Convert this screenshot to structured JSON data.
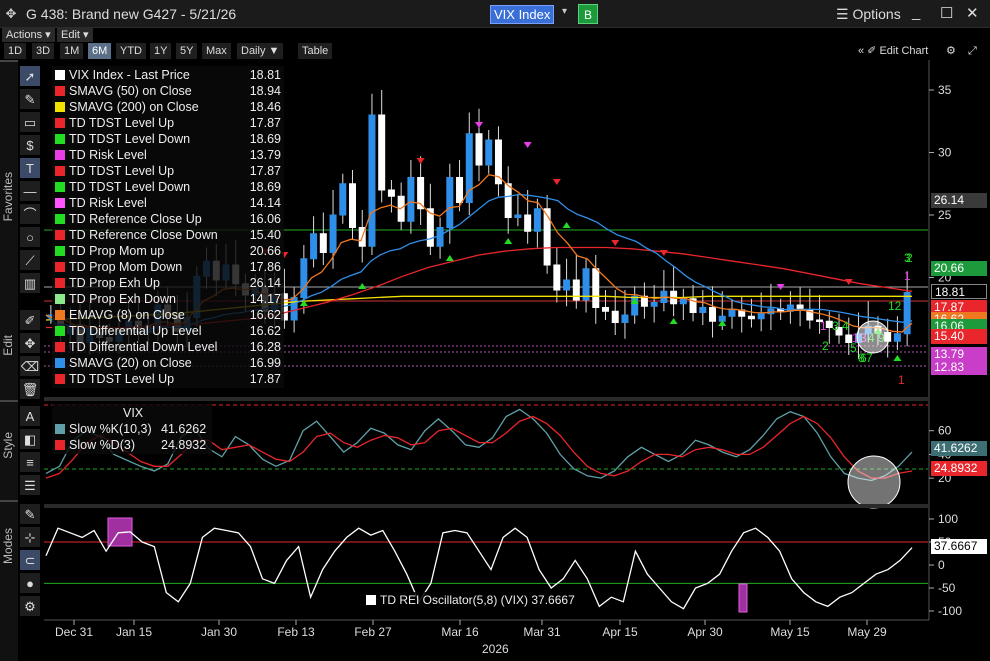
{
  "window": {
    "title": "G 438: Brand new G427 - 5/21/26",
    "ticker": "VIX Index",
    "badge": "B",
    "options_label": "Options",
    "move_icon": "✥",
    "min_icon": "_",
    "max_icon": "☐",
    "close_icon": "✕",
    "dropdown_icon": "▾"
  },
  "menu": {
    "actions": "Actions ▾",
    "edit": "Edit ▾"
  },
  "toolbar": {
    "timeframes": [
      "1D",
      "3D",
      "1M",
      "6M",
      "YTD",
      "1Y",
      "5Y",
      "Max"
    ],
    "active_timeframe": "6M",
    "interval": "Daily ▼",
    "table": "Table",
    "edit_chart": "« ✐ Edit Chart",
    "gear": "⚙",
    "expand": "⤢"
  },
  "sidebar": {
    "favorites": "Favorites",
    "edit": "Edit",
    "style": "Style",
    "modes": "Modes"
  },
  "legend_main": [
    {
      "name": "VIX Index - Last Price",
      "value": "18.81",
      "color": "#ffffff"
    },
    {
      "name": "SMAVG (50)  on Close",
      "value": "18.94",
      "color": "#e8262b"
    },
    {
      "name": "SMAVG (200)  on Close",
      "value": "18.46",
      "color": "#f2e200"
    },
    {
      "name": "TD TDST Level Up",
      "value": "17.87",
      "color": "#e8262b"
    },
    {
      "name": "TD TDST Level Down",
      "value": "18.69",
      "color": "#22dd22"
    },
    {
      "name": "TD Risk Level",
      "value": "13.79",
      "color": "#e83ee8"
    },
    {
      "name": "TD TDST Level Up",
      "value": "17.87",
      "color": "#e8262b"
    },
    {
      "name": "TD TDST Level Down",
      "value": "18.69",
      "color": "#22dd22"
    },
    {
      "name": "TD Risk Level",
      "value": "14.14",
      "color": "#ff55ff"
    },
    {
      "name": "TD Reference Close Up",
      "value": "16.06",
      "color": "#22dd22"
    },
    {
      "name": "TD Reference Close Down",
      "value": "15.40",
      "color": "#e8262b"
    },
    {
      "name": "TD Prop Mom up",
      "value": "20.66",
      "color": "#22dd22"
    },
    {
      "name": "TD Prop Mom Down",
      "value": "17.86",
      "color": "#e8262b"
    },
    {
      "name": "TD Prop Exh Up",
      "value": "26.14",
      "color": "#e8262b"
    },
    {
      "name": "TD Prop Exh Down",
      "value": "14.17",
      "color": "#8ee88e"
    },
    {
      "name": "EMAVG (8)  on Close",
      "value": "16.62",
      "color": "#f07820"
    },
    {
      "name": "TD Differential Up Level",
      "value": "16.62",
      "color": "#22dd22"
    },
    {
      "name": "TD Differential Down Level",
      "value": "16.28",
      "color": "#e8262b"
    },
    {
      "name": "SMAVG (20)  on Close",
      "value": "16.99",
      "color": "#2f8fe8"
    },
    {
      "name": "TD TDST Level Up",
      "value": "17.87",
      "color": "#e8262b"
    }
  ],
  "legend_stoch": {
    "title": "VIX",
    "rows": [
      {
        "name": "Slow %K(10,3)",
        "value": "41.6262",
        "color": "#5fa0a8"
      },
      {
        "name": "Slow %D(3)",
        "value": "24.8932",
        "color": "#e8262b"
      }
    ]
  },
  "legend_rei": {
    "name": "TD REI Oscillator(5,8) (VIX)",
    "value": "37.6667",
    "color": "#ffffff"
  },
  "axes": {
    "main_ticks": [
      "35",
      "30",
      "25",
      "20"
    ],
    "stoch_ticks": [
      "60",
      "40",
      "20"
    ],
    "rei_ticks": [
      "100",
      "50",
      "0",
      "-50",
      "-100"
    ],
    "x_labels": [
      "Dec 31",
      "Jan 15",
      "Jan 30",
      "Feb 13",
      "Feb 27",
      "Mar 16",
      "Mar 31",
      "Apr 15",
      "Apr 30",
      "May 15",
      "May 29"
    ],
    "year": "2026"
  },
  "price_tags": [
    {
      "value": "26.14",
      "bg": "#3a3a3a",
      "fg": "#ffffff"
    },
    {
      "value": "20.66",
      "bg": "#1d9a3b",
      "fg": "#ffffff"
    },
    {
      "value": "18.81",
      "bg": "#000000",
      "fg": "#ffffff"
    },
    {
      "value": "17.87",
      "bg": "#e8262b",
      "fg": "#ffffff"
    },
    {
      "value": "16.62",
      "bg": "#f07820",
      "fg": "#ffffff"
    },
    {
      "value": "16.06",
      "bg": "#1d9a3b",
      "fg": "#ffffff"
    },
    {
      "value": "15.40",
      "bg": "#e8262b",
      "fg": "#ffffff"
    },
    {
      "value": "13.79",
      "bg": "#c83ec8",
      "fg": "#ffffff"
    },
    {
      "value": "12.83",
      "bg": "#c83ec8",
      "fg": "#ffffff"
    }
  ],
  "stoch_tags": [
    {
      "value": "41.6262",
      "bg": "#3d6e74",
      "fg": "#ffffff"
    },
    {
      "value": "24.8932",
      "bg": "#e8262b",
      "fg": "#ffffff"
    }
  ],
  "rei_tag": {
    "value": "37.6667",
    "bg": "#ffffff",
    "fg": "#000000"
  },
  "td_counts": [
    "1",
    "3",
    "4",
    "2",
    "1",
    "3",
    "4",
    "5",
    "8",
    "9",
    "7",
    "6",
    "1",
    "2",
    "12",
    "3",
    "1"
  ],
  "chart_data": {
    "type": "candlestick",
    "ylim": [
      11,
      38
    ],
    "close_series": [
      17.0,
      15.5,
      16.2,
      14.8,
      16.0,
      15.2,
      14.9,
      15.8,
      16.5,
      15.6,
      16.2,
      17.8,
      16.9,
      15.7,
      16.8,
      20.1,
      21.3,
      19.8,
      21.0,
      19.5,
      18.6,
      19.2,
      17.3,
      18.7,
      16.6,
      18.4,
      21.5,
      23.5,
      22.0,
      25.0,
      27.5,
      24.0,
      22.5,
      33.0,
      27.0,
      26.5,
      24.5,
      28.0,
      25.5,
      22.5,
      24.0,
      28.0,
      26.0,
      31.5,
      29.0,
      31.0,
      27.5,
      24.8,
      25.0,
      23.7,
      25.5,
      21.0,
      19.0,
      19.8,
      18.2,
      20.7,
      17.6,
      17.3,
      16.4,
      17.0,
      18.5,
      17.7,
      18.0,
      18.9,
      17.9,
      18.3,
      17.2,
      17.6,
      16.5,
      16.9,
      17.4,
      16.9,
      16.7,
      17.1,
      17.5,
      17.3,
      17.8,
      17.4,
      16.6,
      16.5,
      16.0,
      15.4,
      14.8,
      15.5,
      16.1,
      15.6,
      14.9,
      15.5,
      18.8
    ],
    "sma50": [
      16.0,
      16.0,
      16.0,
      16.0,
      16.1,
      16.2,
      16.3,
      16.5,
      16.7,
      17.0,
      17.5,
      18.0,
      18.6,
      19.3,
      20.1,
      20.8,
      21.3,
      21.8,
      22.1,
      22.3,
      22.4,
      22.4,
      22.4,
      22.3,
      22.1,
      21.9,
      21.6,
      21.3,
      21.0,
      20.7,
      20.3,
      19.9,
      19.5,
      19.2,
      18.9
    ],
    "sma200": [
      16.6,
      16.7,
      16.8,
      16.9,
      17.0,
      17.1,
      17.3,
      17.5,
      17.7,
      17.9,
      18.1,
      18.2,
      18.3,
      18.4,
      18.5,
      18.5,
      18.5,
      18.5,
      18.5,
      18.5,
      18.5,
      18.5,
      18.5,
      18.4,
      18.4,
      18.4,
      18.5,
      18.5,
      18.5,
      18.5,
      18.5,
      18.5,
      18.5,
      18.5,
      18.5
    ],
    "stoch_k": [
      24,
      30,
      52,
      60,
      55,
      40,
      35,
      30,
      26,
      32,
      55,
      62,
      45,
      38,
      55,
      48,
      36,
      30,
      35,
      60,
      68,
      55,
      42,
      50,
      62,
      58,
      48,
      44,
      60,
      70,
      60,
      48,
      46,
      54,
      72,
      78,
      70,
      58,
      40,
      28,
      22,
      20,
      26,
      38,
      46,
      40,
      34,
      40,
      52,
      48,
      42,
      38,
      44,
      56,
      70,
      76,
      72,
      58,
      38,
      24,
      20,
      18,
      22,
      30,
      42
    ],
    "stoch_d": [
      20,
      24,
      36,
      50,
      56,
      50,
      42,
      34,
      30,
      30,
      40,
      52,
      52,
      44,
      46,
      48,
      42,
      36,
      34,
      42,
      55,
      58,
      50,
      46,
      52,
      56,
      54,
      48,
      50,
      60,
      62,
      56,
      50,
      50,
      58,
      68,
      72,
      66,
      56,
      42,
      30,
      24,
      22,
      26,
      34,
      40,
      40,
      38,
      44,
      46,
      44,
      40,
      40,
      46,
      56,
      66,
      72,
      66,
      54,
      38,
      26,
      20,
      20,
      24,
      26
    ],
    "rei": [
      20,
      80,
      70,
      60,
      75,
      30,
      70,
      72,
      50,
      40,
      -60,
      -80,
      -40,
      60,
      80,
      75,
      70,
      40,
      -30,
      -40,
      10,
      40,
      -70,
      -10,
      30,
      60,
      80,
      65,
      75,
      30,
      -20,
      -80,
      -40,
      70,
      75,
      70,
      30,
      -10,
      60,
      80,
      60,
      -10,
      -50,
      -30,
      10,
      -30,
      -90,
      -70,
      -80,
      30,
      -20,
      -50,
      -80,
      -95,
      -50,
      -40,
      -20,
      30,
      70,
      80,
      60,
      30,
      -30,
      -60,
      -80,
      -90,
      -70,
      -60,
      -40,
      -20,
      -10,
      10,
      37.7
    ],
    "rei_lines": {
      "top": 50,
      "bottom": -40
    }
  }
}
